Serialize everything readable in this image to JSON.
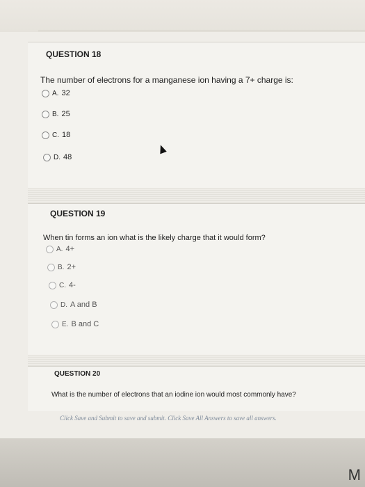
{
  "questions": [
    {
      "title": "QUESTION 18",
      "text": "The number of electrons for a manganese ion having a 7+ charge is:",
      "options": [
        {
          "letter": "A.",
          "label": "32"
        },
        {
          "letter": "B.",
          "label": "25"
        },
        {
          "letter": "C.",
          "label": "18"
        },
        {
          "letter": "D.",
          "label": "48"
        }
      ]
    },
    {
      "title": "QUESTION 19",
      "text": "When tin forms an ion what is the likely charge that it would form?",
      "options": [
        {
          "letter": "A.",
          "label": "4+"
        },
        {
          "letter": "B.",
          "label": "2+"
        },
        {
          "letter": "C.",
          "label": "4-"
        },
        {
          "letter": "D.",
          "label": "A and B"
        },
        {
          "letter": "E.",
          "label": "B and C"
        }
      ]
    },
    {
      "title": "QUESTION 20",
      "text": "What is the number of electrons that an iodine ion would most commonly have?"
    }
  ],
  "footer": {
    "note": "Click Save and Submit to save and submit. Click Save All Answers to save all answers."
  },
  "bezel": {
    "brand_letter": "M"
  }
}
